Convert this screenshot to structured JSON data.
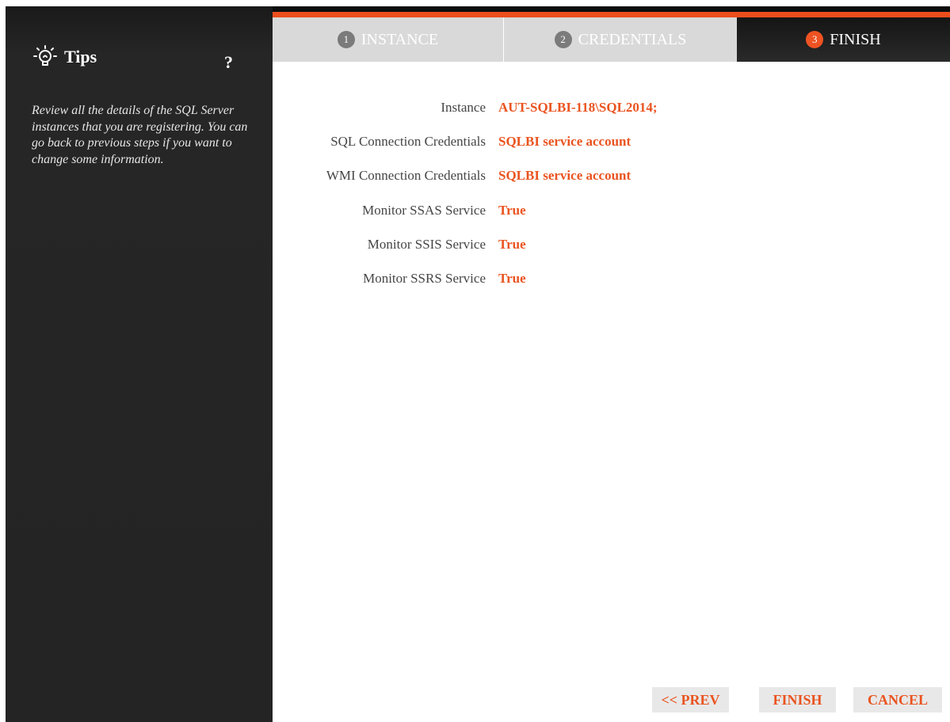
{
  "sidebar": {
    "title": "Tips",
    "help": "?",
    "text": "Review all the details of the SQL Server instances that you are registering. You can go back to previous steps if you want to change some information."
  },
  "steps": [
    {
      "number": "1",
      "label": "INSTANCE",
      "state": "inactive"
    },
    {
      "number": "2",
      "label": "CREDENTIALS",
      "state": "inactive"
    },
    {
      "number": "3",
      "label": "FINISH",
      "state": "active"
    }
  ],
  "details": [
    {
      "label": "Instance",
      "value": "AUT-SQLBI-118\\SQL2014;"
    },
    {
      "label": "SQL Connection Credentials",
      "value": "SQLBI service account"
    },
    {
      "label": "WMI Connection Credentials",
      "value": "SQLBI service account"
    },
    {
      "label": "Monitor SSAS Service",
      "value": "True"
    },
    {
      "label": "Monitor SSIS Service",
      "value": "True"
    },
    {
      "label": "Monitor SSRS Service",
      "value": "True"
    }
  ],
  "buttons": {
    "prev": "<< PREV",
    "finish": "FINISH",
    "cancel": "CANCEL"
  },
  "colors": {
    "accent": "#ea5420",
    "sidebar_bg": "#242424",
    "tab_inactive": "#d9d9d9"
  },
  "icons": {
    "tips": "lightbulb-icon"
  }
}
